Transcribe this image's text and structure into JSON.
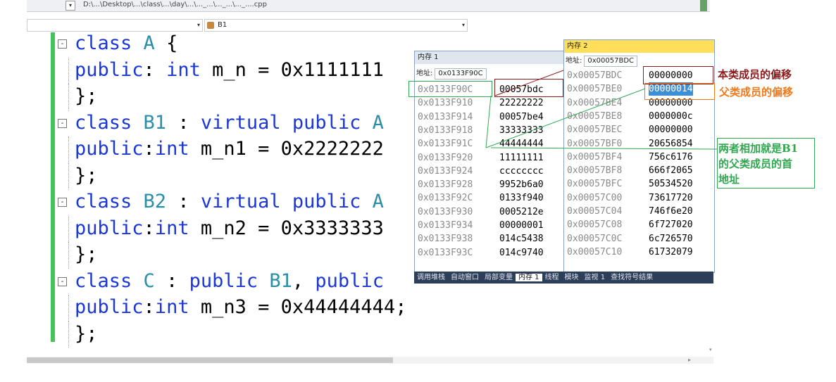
{
  "path_bar": {
    "text": "D:\\...\\Desktop\\...\\class\\...\\day\\...\\..._...\\..._...\\..._....cpp"
  },
  "nav": {
    "scope_value": "",
    "member_value": "B1"
  },
  "code": {
    "lines": [
      {
        "fold": "-",
        "parts": [
          {
            "t": "class",
            "c": "kw"
          },
          {
            "t": " A ",
            "c": "cls"
          },
          {
            "t": "{",
            "c": ""
          }
        ]
      },
      {
        "fold": "",
        "parts": [
          {
            "t": "public",
            "c": "kw"
          },
          {
            "t": ": ",
            "c": ""
          },
          {
            "t": "int",
            "c": "kw"
          },
          {
            "t": " m_n = 0x1111111",
            "c": ""
          }
        ]
      },
      {
        "fold": "",
        "parts": [
          {
            "t": "};",
            "c": ""
          }
        ]
      },
      {
        "fold": "-",
        "parts": [
          {
            "t": "class",
            "c": "kw"
          },
          {
            "t": " B1",
            "c": "cls"
          },
          {
            "t": " : ",
            "c": ""
          },
          {
            "t": "virtual public",
            "c": "kw"
          },
          {
            "t": " A",
            "c": "cls"
          }
        ]
      },
      {
        "fold": "",
        "parts": [
          {
            "t": "public",
            "c": "kw"
          },
          {
            "t": ":",
            "c": ""
          },
          {
            "t": "int",
            "c": "kw"
          },
          {
            "t": " m_n1 = 0x2222222",
            "c": ""
          }
        ]
      },
      {
        "fold": "",
        "parts": [
          {
            "t": "};",
            "c": ""
          }
        ]
      },
      {
        "fold": "-",
        "parts": [
          {
            "t": "class",
            "c": "kw"
          },
          {
            "t": " B2",
            "c": "cls"
          },
          {
            "t": " : ",
            "c": ""
          },
          {
            "t": "virtual public",
            "c": "kw"
          },
          {
            "t": " A",
            "c": "cls"
          }
        ]
      },
      {
        "fold": "",
        "parts": [
          {
            "t": "public",
            "c": "kw"
          },
          {
            "t": ":",
            "c": ""
          },
          {
            "t": "int",
            "c": "kw"
          },
          {
            "t": " m_n2 = 0x3333333",
            "c": ""
          }
        ]
      },
      {
        "fold": "",
        "parts": [
          {
            "t": "};",
            "c": ""
          }
        ]
      },
      {
        "fold": "-",
        "parts": [
          {
            "t": "class",
            "c": "kw"
          },
          {
            "t": " C",
            "c": "cls"
          },
          {
            "t": " : ",
            "c": ""
          },
          {
            "t": "public",
            "c": "kw"
          },
          {
            "t": " B1",
            "c": "cls"
          },
          {
            "t": ", ",
            "c": ""
          },
          {
            "t": "public",
            "c": "kw"
          }
        ]
      },
      {
        "fold": "",
        "parts": [
          {
            "t": "public",
            "c": "kw"
          },
          {
            "t": ":",
            "c": ""
          },
          {
            "t": "int",
            "c": "kw"
          },
          {
            "t": " m_n3 = 0x44444444;",
            "c": ""
          }
        ]
      },
      {
        "fold": "",
        "parts": [
          {
            "t": "};",
            "c": ""
          }
        ]
      }
    ]
  },
  "memory1": {
    "title": "内存 1",
    "address_label": "地址:",
    "address_value": "0x0133F90C",
    "rows": [
      {
        "addr": "0x0133F90C",
        "val": "00057bdc"
      },
      {
        "addr": "0x0133F910",
        "val": "22222222"
      },
      {
        "addr": "0x0133F914",
        "val": "00057be4"
      },
      {
        "addr": "0x0133F918",
        "val": "33333333"
      },
      {
        "addr": "0x0133F91C",
        "val": "44444444"
      },
      {
        "addr": "0x0133F920",
        "val": "11111111"
      },
      {
        "addr": "0x0133F924",
        "val": "cccccccc"
      },
      {
        "addr": "0x0133F928",
        "val": "9952b6a0"
      },
      {
        "addr": "0x0133F92C",
        "val": "0133f940"
      },
      {
        "addr": "0x0133F930",
        "val": "0005212e"
      },
      {
        "addr": "0x0133F934",
        "val": "00000001"
      },
      {
        "addr": "0x0133F938",
        "val": "014c5438"
      },
      {
        "addr": "0x0133F93C",
        "val": "014c9740"
      }
    ]
  },
  "memory2": {
    "title": "内存 2",
    "address_label": "地址:",
    "address_value": "0x00057BDC",
    "rows": [
      {
        "addr": "0x00057BDC",
        "val": "00000000"
      },
      {
        "addr": "0x00057BE0",
        "val": "00000014"
      },
      {
        "addr": "0x00057BE4",
        "val": "00000000"
      },
      {
        "addr": "0x00057BE8",
        "val": "0000000c"
      },
      {
        "addr": "0x00057BEC",
        "val": "00000000"
      },
      {
        "addr": "0x00057BF0",
        "val": "20656854"
      },
      {
        "addr": "0x00057BF4",
        "val": "756c6176"
      },
      {
        "addr": "0x00057BF8",
        "val": "666f2065"
      },
      {
        "addr": "0x00057BFC",
        "val": "50534520"
      },
      {
        "addr": "0x00057C00",
        "val": "73617720"
      },
      {
        "addr": "0x00057C04",
        "val": "746f6e20"
      },
      {
        "addr": "0x00057C08",
        "val": "6f727020"
      },
      {
        "addr": "0x00057C0C",
        "val": "6c726570"
      },
      {
        "addr": "0x00057C10",
        "val": "61732079"
      }
    ]
  },
  "tabs": [
    "调用堆栈",
    "自动窗口",
    "局部变量",
    "内存 1",
    "线程",
    "模块",
    "监视 1",
    "查找符号结果"
  ],
  "active_tab": "内存 1",
  "annotations": {
    "own_member_offset": "本类成员的偏移",
    "parent_member_offset": "父类成员的偏移",
    "sum_line1": "两者相加就是B1",
    "sum_line2": "的父类成员的首",
    "sum_line3": "地址"
  },
  "colors": {
    "keyword": "#1b37d8",
    "class_name": "#2a8ea8",
    "gutter": "#48c25a",
    "annotation_red": "#8b1a1a",
    "annotation_orange": "#f07a1a",
    "annotation_green": "#2fa84f",
    "selection": "#3d8fd6",
    "memory2_title": "#ffde59"
  }
}
